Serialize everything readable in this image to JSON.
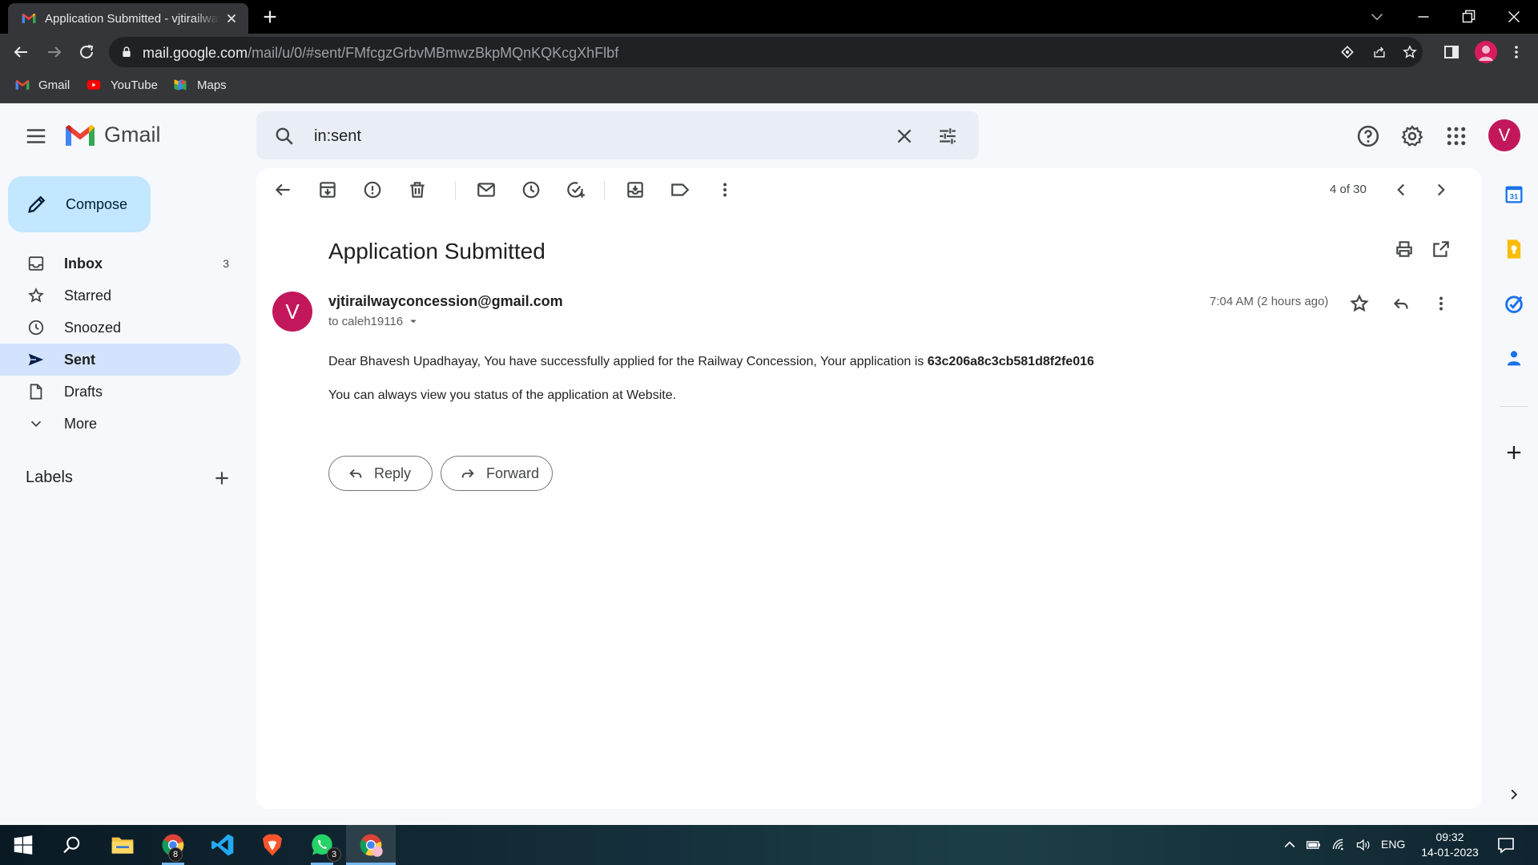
{
  "browser": {
    "tab_title": "Application Submitted - vjtirailway",
    "url_host": "mail.google.com",
    "url_path": "/mail/u/0/#sent/FMfcgzGrbvMBmwzBkpMQnKQKcgXhFlbf",
    "bookmarks": [
      {
        "label": "Gmail",
        "icon": "gmail-icon"
      },
      {
        "label": "YouTube",
        "icon": "youtube-icon"
      },
      {
        "label": "Maps",
        "icon": "maps-icon"
      }
    ]
  },
  "gmail": {
    "brand": "Gmail",
    "search_value": "in:sent",
    "avatar_letter": "V",
    "compose_label": "Compose",
    "nav": [
      {
        "label": "Inbox",
        "count": "3",
        "icon": "inbox-icon"
      },
      {
        "label": "Starred",
        "count": "",
        "icon": "star-icon"
      },
      {
        "label": "Snoozed",
        "count": "",
        "icon": "clock-icon"
      },
      {
        "label": "Sent",
        "count": "",
        "icon": "send-icon"
      },
      {
        "label": "Drafts",
        "count": "",
        "icon": "draft-icon"
      },
      {
        "label": "More",
        "count": "",
        "icon": "chevron-down-icon"
      }
    ],
    "labels_heading": "Labels",
    "pager": "4 of 30",
    "message": {
      "subject": "Application Submitted",
      "avatar_letter": "V",
      "sender": "vjtirailwayconcession@gmail.com",
      "recipient": "to caleh19116",
      "time": "7:04 AM (2 hours ago)",
      "body_line1_prefix": "Dear Bhavesh Upadhayay, You have successfully applied for the Railway Concession, Your application is ",
      "application_id": "63c206a8c3cb581d8f2fe016",
      "body_line2": "You can always view you status of the application at Website."
    },
    "reply_label": "Reply",
    "forward_label": "Forward"
  },
  "taskbar": {
    "language": "ENG",
    "time": "09:32",
    "date": "14-01-2023",
    "chrome_badge": "8",
    "whatsapp_badge": "3"
  },
  "colors": {
    "accent_blue": "#c2e7ff",
    "active_nav": "#d3e3fd",
    "avatar": "#c2185b"
  }
}
